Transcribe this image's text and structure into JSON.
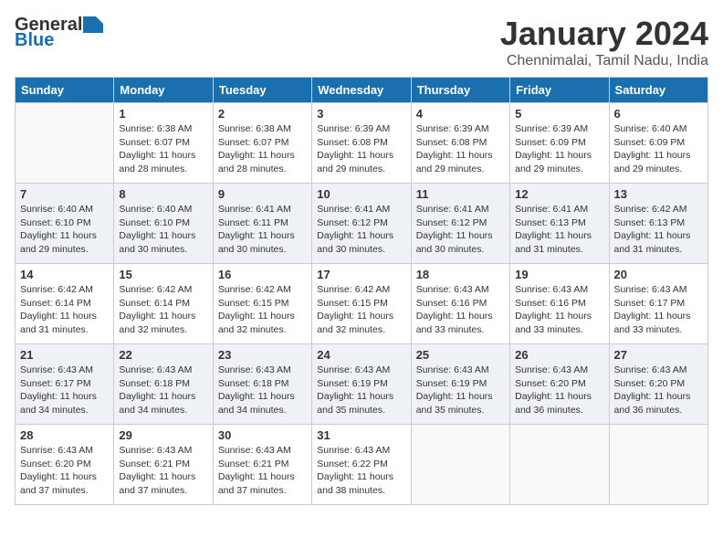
{
  "logo": {
    "text_general": "General",
    "text_blue": "Blue"
  },
  "title": "January 2024",
  "subtitle": "Chennimalai, Tamil Nadu, India",
  "days_of_week": [
    "Sunday",
    "Monday",
    "Tuesday",
    "Wednesday",
    "Thursday",
    "Friday",
    "Saturday"
  ],
  "weeks": [
    [
      {
        "day": "",
        "sunrise": "",
        "sunset": "",
        "daylight": ""
      },
      {
        "day": "1",
        "sunrise": "Sunrise: 6:38 AM",
        "sunset": "Sunset: 6:07 PM",
        "daylight": "Daylight: 11 hours and 28 minutes."
      },
      {
        "day": "2",
        "sunrise": "Sunrise: 6:38 AM",
        "sunset": "Sunset: 6:07 PM",
        "daylight": "Daylight: 11 hours and 28 minutes."
      },
      {
        "day": "3",
        "sunrise": "Sunrise: 6:39 AM",
        "sunset": "Sunset: 6:08 PM",
        "daylight": "Daylight: 11 hours and 29 minutes."
      },
      {
        "day": "4",
        "sunrise": "Sunrise: 6:39 AM",
        "sunset": "Sunset: 6:08 PM",
        "daylight": "Daylight: 11 hours and 29 minutes."
      },
      {
        "day": "5",
        "sunrise": "Sunrise: 6:39 AM",
        "sunset": "Sunset: 6:09 PM",
        "daylight": "Daylight: 11 hours and 29 minutes."
      },
      {
        "day": "6",
        "sunrise": "Sunrise: 6:40 AM",
        "sunset": "Sunset: 6:09 PM",
        "daylight": "Daylight: 11 hours and 29 minutes."
      }
    ],
    [
      {
        "day": "7",
        "sunrise": "Sunrise: 6:40 AM",
        "sunset": "Sunset: 6:10 PM",
        "daylight": "Daylight: 11 hours and 29 minutes."
      },
      {
        "day": "8",
        "sunrise": "Sunrise: 6:40 AM",
        "sunset": "Sunset: 6:10 PM",
        "daylight": "Daylight: 11 hours and 30 minutes."
      },
      {
        "day": "9",
        "sunrise": "Sunrise: 6:41 AM",
        "sunset": "Sunset: 6:11 PM",
        "daylight": "Daylight: 11 hours and 30 minutes."
      },
      {
        "day": "10",
        "sunrise": "Sunrise: 6:41 AM",
        "sunset": "Sunset: 6:12 PM",
        "daylight": "Daylight: 11 hours and 30 minutes."
      },
      {
        "day": "11",
        "sunrise": "Sunrise: 6:41 AM",
        "sunset": "Sunset: 6:12 PM",
        "daylight": "Daylight: 11 hours and 30 minutes."
      },
      {
        "day": "12",
        "sunrise": "Sunrise: 6:41 AM",
        "sunset": "Sunset: 6:13 PM",
        "daylight": "Daylight: 11 hours and 31 minutes."
      },
      {
        "day": "13",
        "sunrise": "Sunrise: 6:42 AM",
        "sunset": "Sunset: 6:13 PM",
        "daylight": "Daylight: 11 hours and 31 minutes."
      }
    ],
    [
      {
        "day": "14",
        "sunrise": "Sunrise: 6:42 AM",
        "sunset": "Sunset: 6:14 PM",
        "daylight": "Daylight: 11 hours and 31 minutes."
      },
      {
        "day": "15",
        "sunrise": "Sunrise: 6:42 AM",
        "sunset": "Sunset: 6:14 PM",
        "daylight": "Daylight: 11 hours and 32 minutes."
      },
      {
        "day": "16",
        "sunrise": "Sunrise: 6:42 AM",
        "sunset": "Sunset: 6:15 PM",
        "daylight": "Daylight: 11 hours and 32 minutes."
      },
      {
        "day": "17",
        "sunrise": "Sunrise: 6:42 AM",
        "sunset": "Sunset: 6:15 PM",
        "daylight": "Daylight: 11 hours and 32 minutes."
      },
      {
        "day": "18",
        "sunrise": "Sunrise: 6:43 AM",
        "sunset": "Sunset: 6:16 PM",
        "daylight": "Daylight: 11 hours and 33 minutes."
      },
      {
        "day": "19",
        "sunrise": "Sunrise: 6:43 AM",
        "sunset": "Sunset: 6:16 PM",
        "daylight": "Daylight: 11 hours and 33 minutes."
      },
      {
        "day": "20",
        "sunrise": "Sunrise: 6:43 AM",
        "sunset": "Sunset: 6:17 PM",
        "daylight": "Daylight: 11 hours and 33 minutes."
      }
    ],
    [
      {
        "day": "21",
        "sunrise": "Sunrise: 6:43 AM",
        "sunset": "Sunset: 6:17 PM",
        "daylight": "Daylight: 11 hours and 34 minutes."
      },
      {
        "day": "22",
        "sunrise": "Sunrise: 6:43 AM",
        "sunset": "Sunset: 6:18 PM",
        "daylight": "Daylight: 11 hours and 34 minutes."
      },
      {
        "day": "23",
        "sunrise": "Sunrise: 6:43 AM",
        "sunset": "Sunset: 6:18 PM",
        "daylight": "Daylight: 11 hours and 34 minutes."
      },
      {
        "day": "24",
        "sunrise": "Sunrise: 6:43 AM",
        "sunset": "Sunset: 6:19 PM",
        "daylight": "Daylight: 11 hours and 35 minutes."
      },
      {
        "day": "25",
        "sunrise": "Sunrise: 6:43 AM",
        "sunset": "Sunset: 6:19 PM",
        "daylight": "Daylight: 11 hours and 35 minutes."
      },
      {
        "day": "26",
        "sunrise": "Sunrise: 6:43 AM",
        "sunset": "Sunset: 6:20 PM",
        "daylight": "Daylight: 11 hours and 36 minutes."
      },
      {
        "day": "27",
        "sunrise": "Sunrise: 6:43 AM",
        "sunset": "Sunset: 6:20 PM",
        "daylight": "Daylight: 11 hours and 36 minutes."
      }
    ],
    [
      {
        "day": "28",
        "sunrise": "Sunrise: 6:43 AM",
        "sunset": "Sunset: 6:20 PM",
        "daylight": "Daylight: 11 hours and 37 minutes."
      },
      {
        "day": "29",
        "sunrise": "Sunrise: 6:43 AM",
        "sunset": "Sunset: 6:21 PM",
        "daylight": "Daylight: 11 hours and 37 minutes."
      },
      {
        "day": "30",
        "sunrise": "Sunrise: 6:43 AM",
        "sunset": "Sunset: 6:21 PM",
        "daylight": "Daylight: 11 hours and 37 minutes."
      },
      {
        "day": "31",
        "sunrise": "Sunrise: 6:43 AM",
        "sunset": "Sunset: 6:22 PM",
        "daylight": "Daylight: 11 hours and 38 minutes."
      },
      {
        "day": "",
        "sunrise": "",
        "sunset": "",
        "daylight": ""
      },
      {
        "day": "",
        "sunrise": "",
        "sunset": "",
        "daylight": ""
      },
      {
        "day": "",
        "sunrise": "",
        "sunset": "",
        "daylight": ""
      }
    ]
  ]
}
